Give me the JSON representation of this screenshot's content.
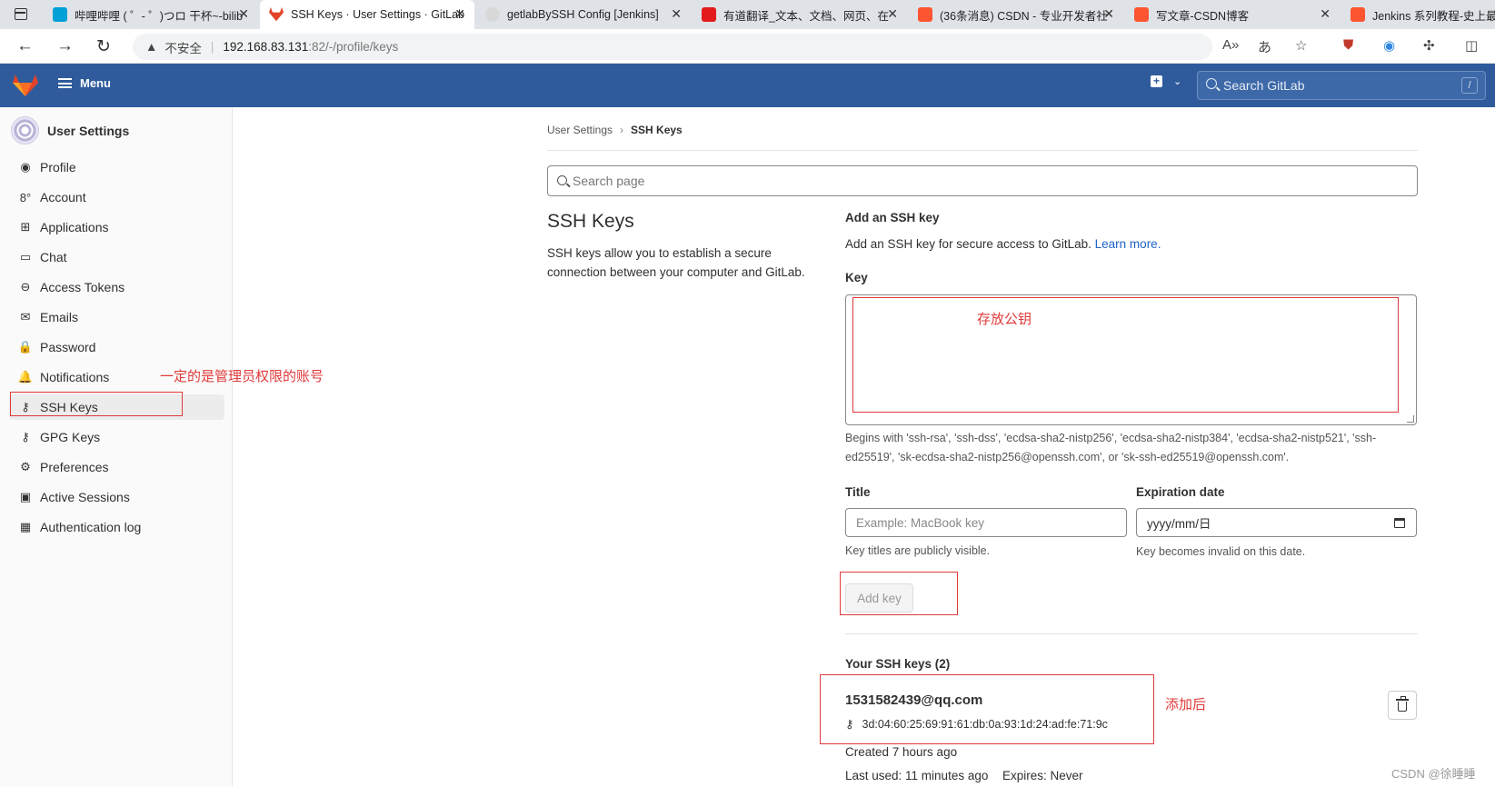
{
  "browser": {
    "tabs": [
      {
        "title": "哔哩哔哩 ( ゜- ゜)つロ 干杯~-bilib",
        "active": false,
        "favicon_color": "#00a1d6"
      },
      {
        "title": "SSH Keys · User Settings · GitLab",
        "active": true,
        "favicon_color": "#e24329"
      },
      {
        "title": "getlabBySSH Config [Jenkins]",
        "active": false,
        "favicon_color": "#d0d0d0"
      },
      {
        "title": "有道翻译_文本、文档、网页、在",
        "active": false,
        "favicon_color": "#e31b1b"
      },
      {
        "title": "(36条消息) CSDN - 专业开发者社",
        "active": false,
        "favicon_color": "#fc5531"
      },
      {
        "title": "写文章-CSDN博客",
        "active": false,
        "favicon_color": "#fc5531"
      },
      {
        "title": "Jenkins 系列教程-史上最简",
        "active": false,
        "favicon_color": "#fc5531"
      }
    ],
    "address": {
      "insecure_label": "不安全",
      "host": "192.168.83.131",
      "path": ":82/-/profile/keys"
    }
  },
  "header": {
    "menu_label": "Menu",
    "search_placeholder": "Search GitLab",
    "search_shortcut": "/",
    "brand_color": "#2f5b9c"
  },
  "sidebar": {
    "title": "User Settings",
    "items": [
      {
        "label": "Profile",
        "icon": "user-icon",
        "glyph": "◉"
      },
      {
        "label": "Account",
        "icon": "account-icon",
        "glyph": "8°"
      },
      {
        "label": "Applications",
        "icon": "applications-icon",
        "glyph": "⊞"
      },
      {
        "label": "Chat",
        "icon": "chat-icon",
        "glyph": "▭"
      },
      {
        "label": "Access Tokens",
        "icon": "token-icon",
        "glyph": "⊖"
      },
      {
        "label": "Emails",
        "icon": "mail-icon",
        "glyph": "✉"
      },
      {
        "label": "Password",
        "icon": "lock-icon",
        "glyph": "🔒"
      },
      {
        "label": "Notifications",
        "icon": "bell-icon",
        "glyph": "🔔"
      },
      {
        "label": "SSH Keys",
        "icon": "key-icon",
        "glyph": "⚷",
        "active": true
      },
      {
        "label": "GPG Keys",
        "icon": "key-icon",
        "glyph": "⚷"
      },
      {
        "label": "Preferences",
        "icon": "preferences-icon",
        "glyph": "⚙"
      },
      {
        "label": "Active Sessions",
        "icon": "monitor-icon",
        "glyph": "▣"
      },
      {
        "label": "Authentication log",
        "icon": "log-icon",
        "glyph": "▦"
      }
    ]
  },
  "annotations": {
    "admin_note": "一定的是管理员权限的账号",
    "store_key_note": "存放公钥",
    "after_add_note": "添加后"
  },
  "main": {
    "breadcrumb": {
      "parent": "User Settings",
      "current": "SSH Keys"
    },
    "search_placeholder": "Search page",
    "heading": "SSH Keys",
    "description": "SSH keys allow you to establish a secure connection between your computer and GitLab.",
    "add_section": {
      "title": "Add an SSH key",
      "intro": "Add an SSH key for secure access to GitLab.",
      "learn_more": "Learn more.",
      "key_label": "Key",
      "key_help": "Begins with 'ssh-rsa', 'ssh-dss', 'ecdsa-sha2-nistp256', 'ecdsa-sha2-nistp384', 'ecdsa-sha2-nistp521', 'ssh-ed25519', 'sk-ecdsa-sha2-nistp256@openssh.com', or 'sk-ssh-ed25519@openssh.com'.",
      "title_label": "Title",
      "title_placeholder": "Example: MacBook key",
      "title_help": "Key titles are publicly visible.",
      "expiration_label": "Expiration date",
      "expiration_value": "yyyy/mm/日",
      "expiration_help": "Key becomes invalid on this date.",
      "add_button": "Add key"
    },
    "your_keys": {
      "title": "Your SSH keys (2)",
      "keys": [
        {
          "title": "1531582439@qq.com",
          "fingerprint": "3d:04:60:25:69:91:61:db:0a:93:1d:24:ad:fe:71:9c",
          "created": "Created 7 hours ago",
          "last_used": "Last used: 11 minutes ago",
          "expires": "Expires: Never"
        }
      ]
    }
  },
  "watermark": "CSDN @徐睡睡"
}
